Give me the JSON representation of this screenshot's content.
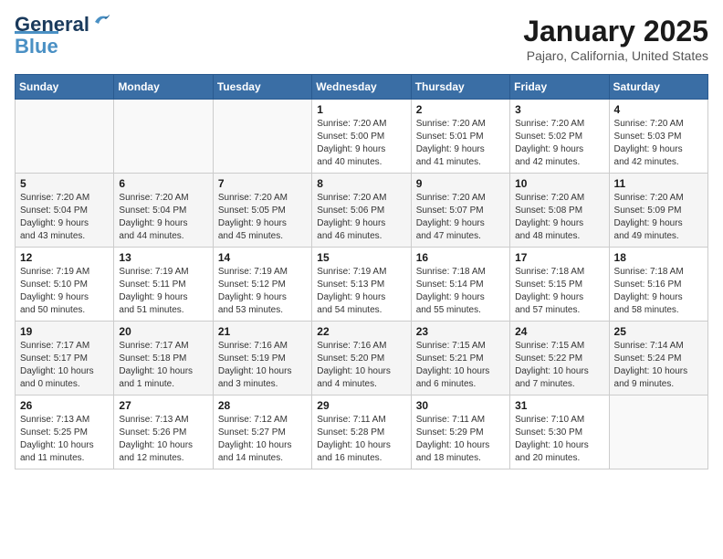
{
  "header": {
    "logo_line1": "General",
    "logo_line2": "Blue",
    "month": "January 2025",
    "location": "Pajaro, California, United States"
  },
  "days_of_week": [
    "Sunday",
    "Monday",
    "Tuesday",
    "Wednesday",
    "Thursday",
    "Friday",
    "Saturday"
  ],
  "weeks": [
    [
      {
        "day": "",
        "info": ""
      },
      {
        "day": "",
        "info": ""
      },
      {
        "day": "",
        "info": ""
      },
      {
        "day": "1",
        "info": "Sunrise: 7:20 AM\nSunset: 5:00 PM\nDaylight: 9 hours\nand 40 minutes."
      },
      {
        "day": "2",
        "info": "Sunrise: 7:20 AM\nSunset: 5:01 PM\nDaylight: 9 hours\nand 41 minutes."
      },
      {
        "day": "3",
        "info": "Sunrise: 7:20 AM\nSunset: 5:02 PM\nDaylight: 9 hours\nand 42 minutes."
      },
      {
        "day": "4",
        "info": "Sunrise: 7:20 AM\nSunset: 5:03 PM\nDaylight: 9 hours\nand 42 minutes."
      }
    ],
    [
      {
        "day": "5",
        "info": "Sunrise: 7:20 AM\nSunset: 5:04 PM\nDaylight: 9 hours\nand 43 minutes."
      },
      {
        "day": "6",
        "info": "Sunrise: 7:20 AM\nSunset: 5:04 PM\nDaylight: 9 hours\nand 44 minutes."
      },
      {
        "day": "7",
        "info": "Sunrise: 7:20 AM\nSunset: 5:05 PM\nDaylight: 9 hours\nand 45 minutes."
      },
      {
        "day": "8",
        "info": "Sunrise: 7:20 AM\nSunset: 5:06 PM\nDaylight: 9 hours\nand 46 minutes."
      },
      {
        "day": "9",
        "info": "Sunrise: 7:20 AM\nSunset: 5:07 PM\nDaylight: 9 hours\nand 47 minutes."
      },
      {
        "day": "10",
        "info": "Sunrise: 7:20 AM\nSunset: 5:08 PM\nDaylight: 9 hours\nand 48 minutes."
      },
      {
        "day": "11",
        "info": "Sunrise: 7:20 AM\nSunset: 5:09 PM\nDaylight: 9 hours\nand 49 minutes."
      }
    ],
    [
      {
        "day": "12",
        "info": "Sunrise: 7:19 AM\nSunset: 5:10 PM\nDaylight: 9 hours\nand 50 minutes."
      },
      {
        "day": "13",
        "info": "Sunrise: 7:19 AM\nSunset: 5:11 PM\nDaylight: 9 hours\nand 51 minutes."
      },
      {
        "day": "14",
        "info": "Sunrise: 7:19 AM\nSunset: 5:12 PM\nDaylight: 9 hours\nand 53 minutes."
      },
      {
        "day": "15",
        "info": "Sunrise: 7:19 AM\nSunset: 5:13 PM\nDaylight: 9 hours\nand 54 minutes."
      },
      {
        "day": "16",
        "info": "Sunrise: 7:18 AM\nSunset: 5:14 PM\nDaylight: 9 hours\nand 55 minutes."
      },
      {
        "day": "17",
        "info": "Sunrise: 7:18 AM\nSunset: 5:15 PM\nDaylight: 9 hours\nand 57 minutes."
      },
      {
        "day": "18",
        "info": "Sunrise: 7:18 AM\nSunset: 5:16 PM\nDaylight: 9 hours\nand 58 minutes."
      }
    ],
    [
      {
        "day": "19",
        "info": "Sunrise: 7:17 AM\nSunset: 5:17 PM\nDaylight: 10 hours\nand 0 minutes."
      },
      {
        "day": "20",
        "info": "Sunrise: 7:17 AM\nSunset: 5:18 PM\nDaylight: 10 hours\nand 1 minute."
      },
      {
        "day": "21",
        "info": "Sunrise: 7:16 AM\nSunset: 5:19 PM\nDaylight: 10 hours\nand 3 minutes."
      },
      {
        "day": "22",
        "info": "Sunrise: 7:16 AM\nSunset: 5:20 PM\nDaylight: 10 hours\nand 4 minutes."
      },
      {
        "day": "23",
        "info": "Sunrise: 7:15 AM\nSunset: 5:21 PM\nDaylight: 10 hours\nand 6 minutes."
      },
      {
        "day": "24",
        "info": "Sunrise: 7:15 AM\nSunset: 5:22 PM\nDaylight: 10 hours\nand 7 minutes."
      },
      {
        "day": "25",
        "info": "Sunrise: 7:14 AM\nSunset: 5:24 PM\nDaylight: 10 hours\nand 9 minutes."
      }
    ],
    [
      {
        "day": "26",
        "info": "Sunrise: 7:13 AM\nSunset: 5:25 PM\nDaylight: 10 hours\nand 11 minutes."
      },
      {
        "day": "27",
        "info": "Sunrise: 7:13 AM\nSunset: 5:26 PM\nDaylight: 10 hours\nand 12 minutes."
      },
      {
        "day": "28",
        "info": "Sunrise: 7:12 AM\nSunset: 5:27 PM\nDaylight: 10 hours\nand 14 minutes."
      },
      {
        "day": "29",
        "info": "Sunrise: 7:11 AM\nSunset: 5:28 PM\nDaylight: 10 hours\nand 16 minutes."
      },
      {
        "day": "30",
        "info": "Sunrise: 7:11 AM\nSunset: 5:29 PM\nDaylight: 10 hours\nand 18 minutes."
      },
      {
        "day": "31",
        "info": "Sunrise: 7:10 AM\nSunset: 5:30 PM\nDaylight: 10 hours\nand 20 minutes."
      },
      {
        "day": "",
        "info": ""
      }
    ]
  ]
}
